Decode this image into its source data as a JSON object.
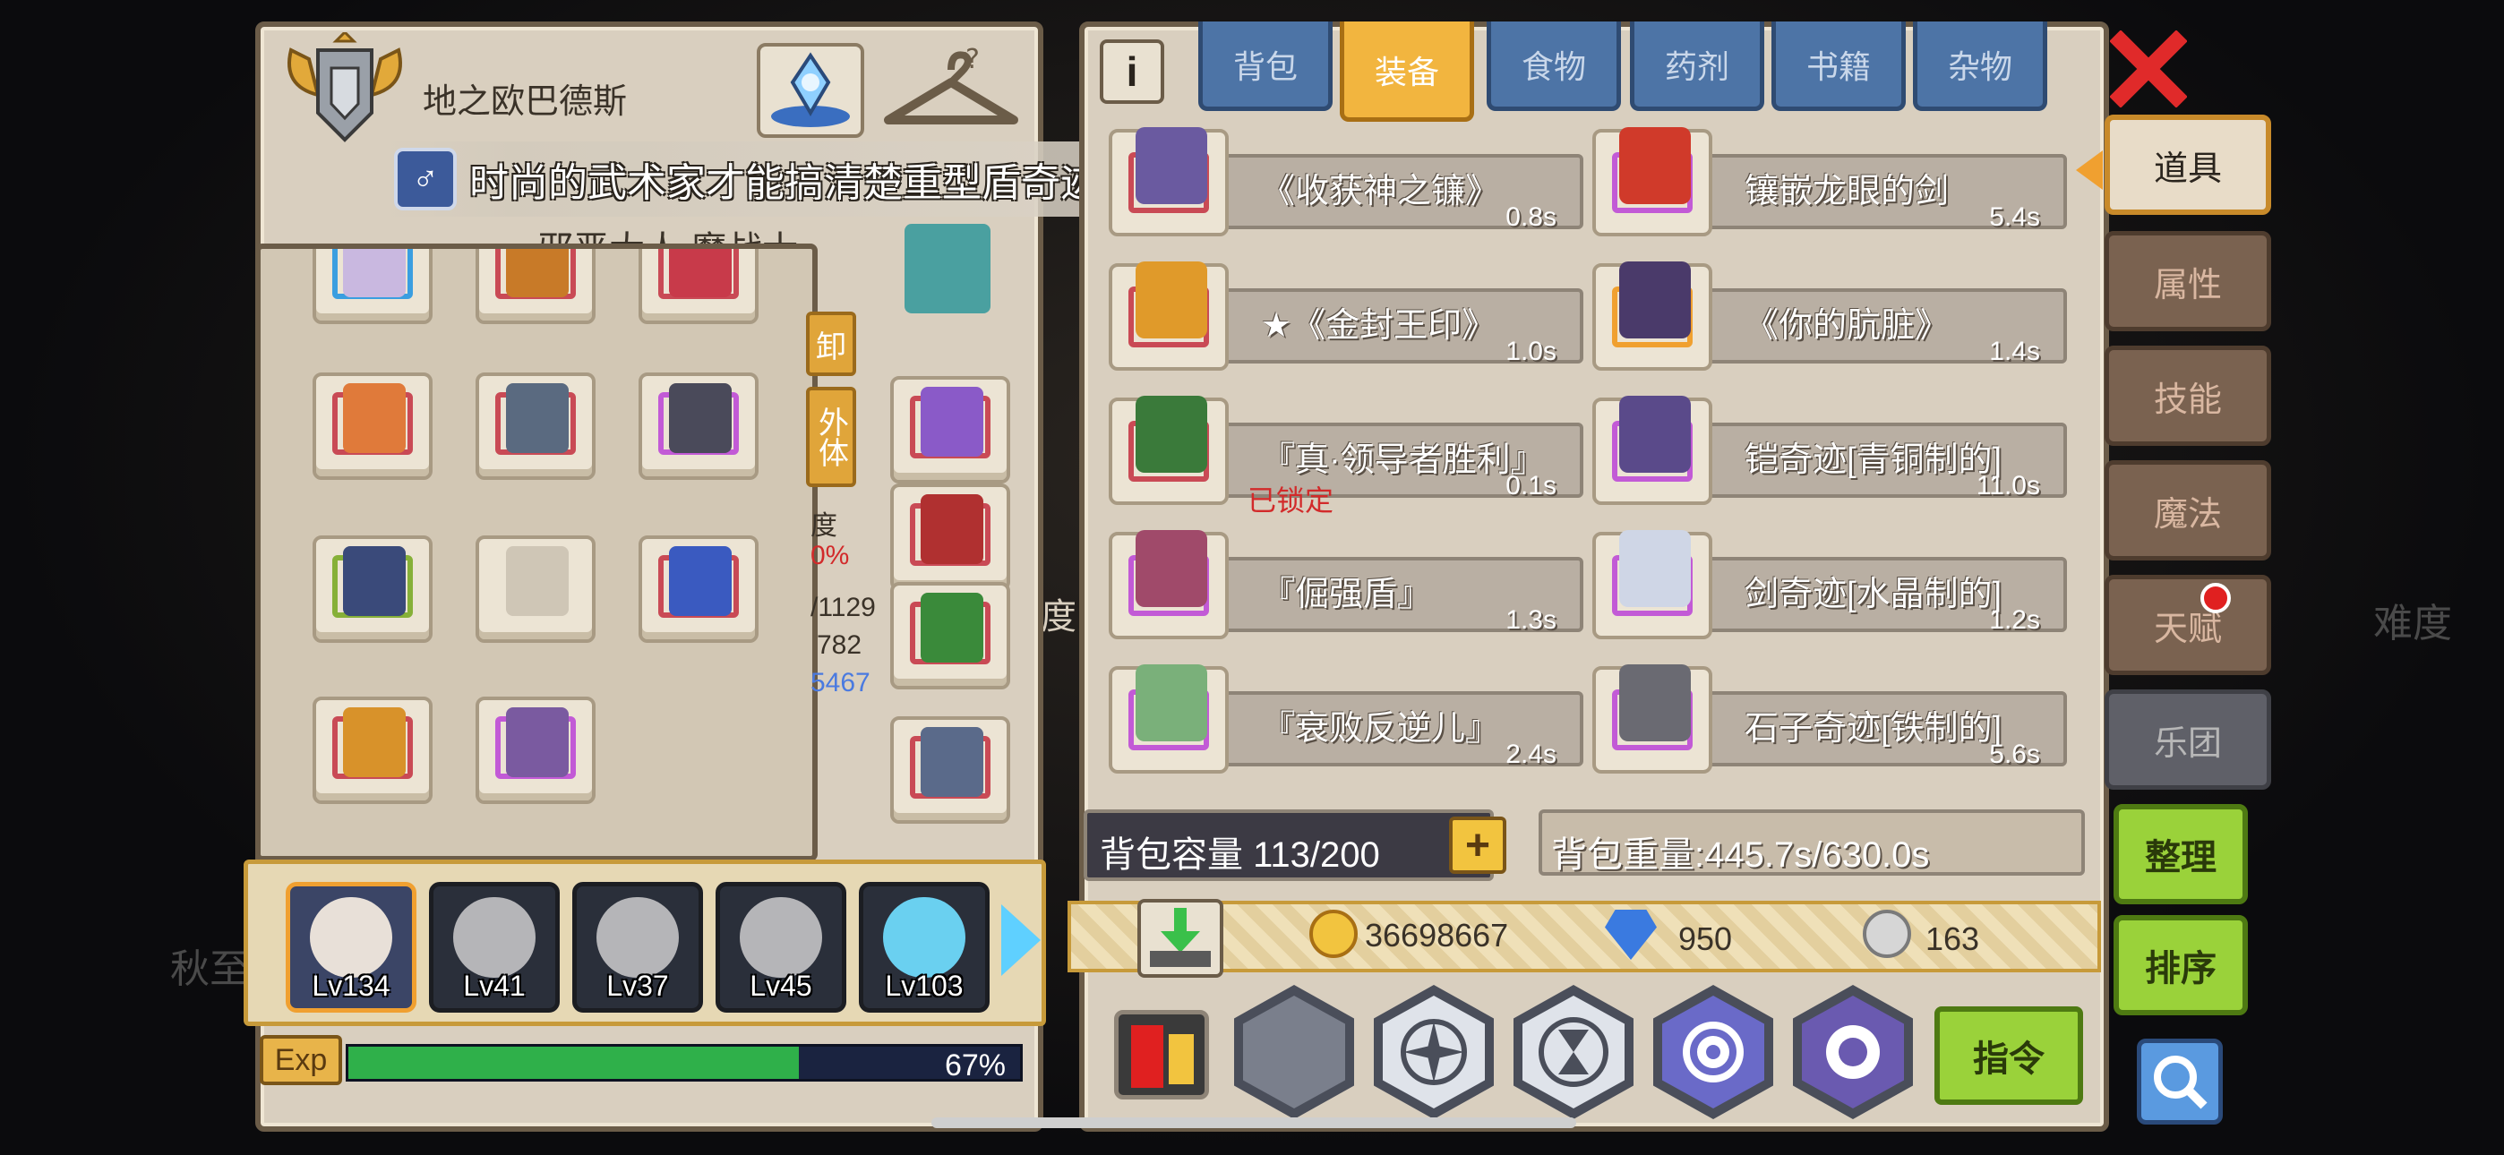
{
  "hero": {
    "name": "地之欧巴德斯",
    "title_peek": "邪恶大人 魔战士"
  },
  "toast": {
    "icon": "male-icon",
    "message": "时尚的武术家才能搞清楚重型盾奇迹[布制的]的情报"
  },
  "left_side_tags": {
    "unequip": "卸",
    "appearance": "外体"
  },
  "stat_fragments": {
    "durability_label": "度",
    "durability_value": "0%",
    "stat_a": "/1129",
    "stat_b": "782",
    "stat_c": "5467"
  },
  "party": {
    "members": [
      {
        "level": "Lv134",
        "active": true
      },
      {
        "level": "Lv41",
        "active": false
      },
      {
        "level": "Lv37",
        "active": false
      },
      {
        "level": "Lv45",
        "active": false
      },
      {
        "level": "Lv103",
        "active": false
      }
    ]
  },
  "exp": {
    "label": "Exp",
    "percent_text": "67%",
    "fraction": 0.67
  },
  "top_tabs": [
    {
      "label": "背包",
      "active": false
    },
    {
      "label": "装备",
      "active": true
    },
    {
      "label": "食物",
      "active": false
    },
    {
      "label": "药剂",
      "active": false
    },
    {
      "label": "书籍",
      "active": false
    },
    {
      "label": "杂物",
      "active": false
    }
  ],
  "items": [
    {
      "name": "《收获神之镰》",
      "time": "0.8s",
      "ring": "red"
    },
    {
      "name": "镶嵌龙眼的剑",
      "time": "5.4s",
      "ring": "none"
    },
    {
      "name": "★《金封王印》",
      "time": "1.0s",
      "ring": "red"
    },
    {
      "name": "《你的肮脏》",
      "time": "1.4s",
      "ring": "orange"
    },
    {
      "name": "『真·领导者胜利』",
      "time": "0.1s",
      "ring": "red",
      "locked": "已锁定"
    },
    {
      "name": "铠奇迹[青铜制的]",
      "time": "11.0s",
      "ring": "purple"
    },
    {
      "name": "『倔强盾』",
      "time": "1.3s",
      "ring": "purple"
    },
    {
      "name": "剑奇迹[水晶制的]",
      "time": "1.2s",
      "ring": "purple"
    },
    {
      "name": "『衰败反逆儿』",
      "time": "2.4s",
      "ring": "purple"
    },
    {
      "name": "石子奇迹[铁制的]",
      "time": "5.6s",
      "ring": "purple"
    }
  ],
  "bag": {
    "capacity_text": "背包容量 113/200",
    "weight_text": "背包重量:445.7s/630.0s"
  },
  "currency": {
    "gold": "36698667",
    "diamond": "950",
    "silver": "163"
  },
  "command_label": "指令",
  "side_tabs": [
    {
      "label": "道具",
      "state": "active"
    },
    {
      "label": "属性",
      "state": "normal"
    },
    {
      "label": "技能",
      "state": "normal"
    },
    {
      "label": "魔法",
      "state": "normal"
    },
    {
      "label": "天赋",
      "state": "normal",
      "badge": true
    },
    {
      "label": "乐团",
      "state": "dim"
    }
  ],
  "actions": {
    "organize": "整理",
    "sort": "排序"
  },
  "background_text": {
    "left": "秋至",
    "right": "难度",
    "mid": "度"
  },
  "colors": {
    "accent_gold": "#f2b53f",
    "tab_blue": "#4d74a6",
    "exp_green": "#2fb04a",
    "locked_red": "#d22a2a",
    "panel_bg": "#d9cfbf"
  }
}
